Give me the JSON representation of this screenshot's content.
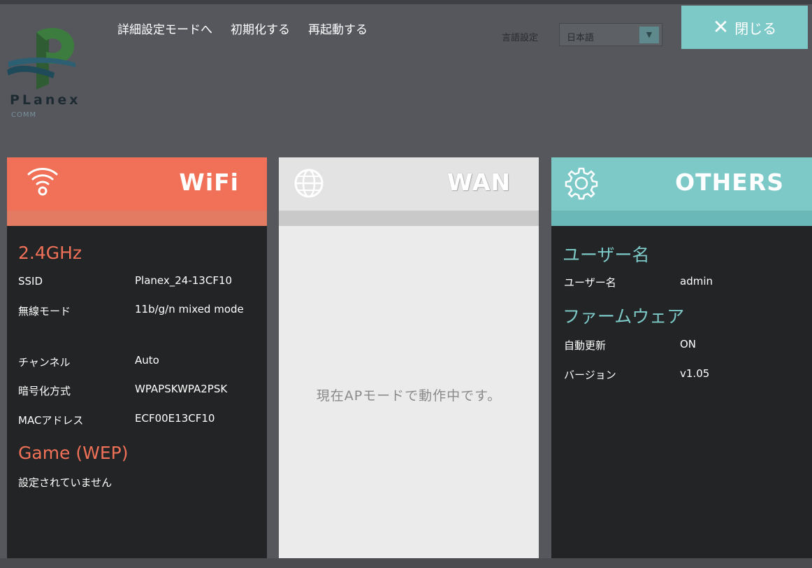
{
  "header": {
    "logo_text": "PLanex",
    "logo_sub": "COMM",
    "nav": [
      "詳細設定モードへ",
      "初期化する",
      "再起動する"
    ],
    "language_label": "言語設定",
    "language_value": "日本語",
    "close_label": "閉じる"
  },
  "wifi": {
    "title": "WiFi",
    "section1_title": "2.4GHz",
    "rows": [
      {
        "label": "SSID",
        "value": "Planex_24-13CF10"
      },
      {
        "label": "無線モード",
        "value": "11b/g/n mixed mode"
      },
      {
        "label": "チャンネル",
        "value": "Auto"
      },
      {
        "label": "暗号化方式",
        "value": "WPAPSKWPA2PSK"
      },
      {
        "label": "MACアドレス",
        "value": "ECF00E13CF10"
      }
    ],
    "section2_title": "Game (WEP)",
    "section2_text": "設定されていません"
  },
  "wan": {
    "title": "WAN",
    "message": "現在APモードで動作中です。"
  },
  "others": {
    "title": "OTHERS",
    "user_section_title": "ユーザー名",
    "user_label": "ユーザー名",
    "user_value": "admin",
    "firmware_section_title": "ファームウェア",
    "auto_update_label": "自動更新",
    "auto_update_value": "ON",
    "version_label": "バージョン",
    "version_value": "v1.05"
  },
  "colors": {
    "wifi_accent": "#f07157",
    "others_accent": "#7dc9c8",
    "background": "#55575c",
    "panel_dark": "#232425"
  },
  "icons": {
    "wifi": "wifi-icon",
    "wan": "globe-icon",
    "others": "gear-icon",
    "close": "close-icon",
    "dropdown": "chevron-down-icon"
  }
}
